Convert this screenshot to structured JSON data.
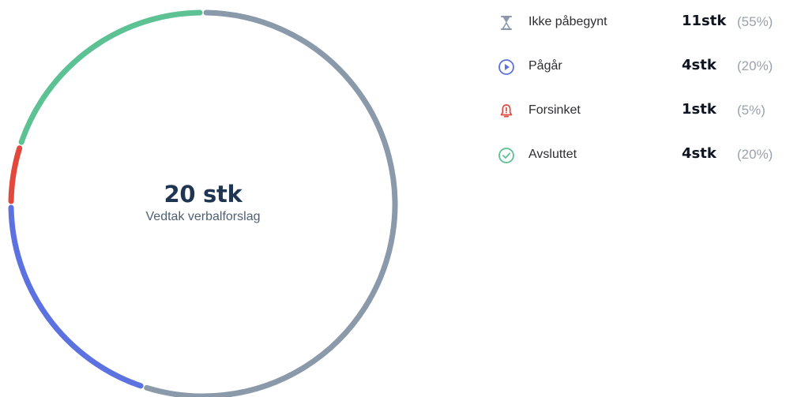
{
  "center": {
    "value": "20 stk",
    "label": "Vedtak verbalforslag"
  },
  "legend": [
    {
      "label": "Ikke påbegynt",
      "count": "11stk",
      "percent": "(55%)",
      "icon": "hourglass-icon",
      "color": "#8a9aab"
    },
    {
      "label": "Pågår",
      "count": "4stk",
      "percent": "(20%)",
      "icon": "play-circle-icon",
      "color": "#5b72e0"
    },
    {
      "label": "Forsinket",
      "count": "1stk",
      "percent": "(5%)",
      "icon": "bell-alert-icon",
      "color": "#e2483b"
    },
    {
      "label": "Avsluttet",
      "count": "4stk",
      "percent": "(20%)",
      "icon": "check-circle-icon",
      "color": "#5cc193"
    }
  ],
  "chart_data": {
    "type": "donut",
    "total": 20,
    "total_label": "Vedtak verbalforslag",
    "series": [
      {
        "name": "Ikke påbegynt",
        "value": 11,
        "percent": 55,
        "color": "#8a9aab"
      },
      {
        "name": "Pågår",
        "value": 4,
        "percent": 20,
        "color": "#5b72e0"
      },
      {
        "name": "Forsinket",
        "value": 1,
        "percent": 5,
        "color": "#e2483b"
      },
      {
        "name": "Avsluttet",
        "value": 4,
        "percent": 20,
        "color": "#5cc193"
      }
    ]
  }
}
